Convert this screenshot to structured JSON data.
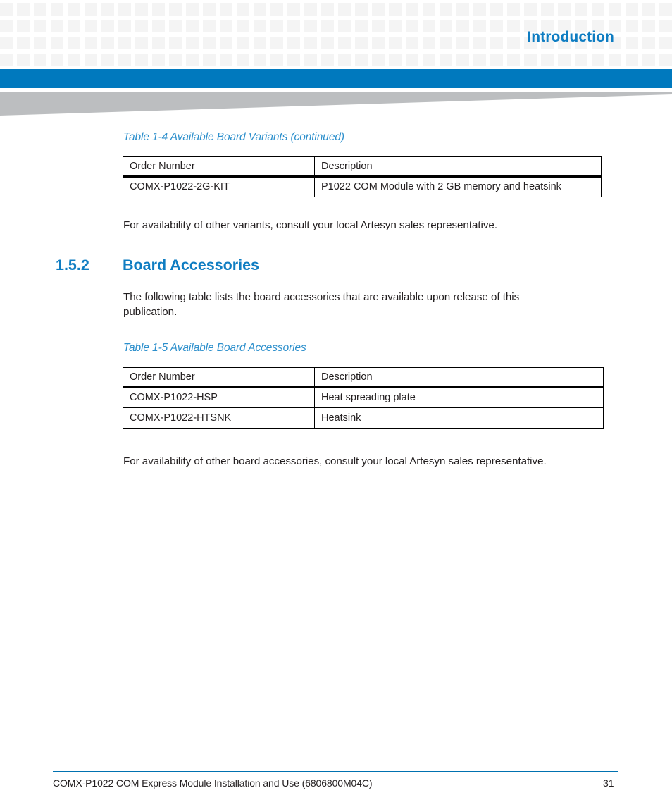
{
  "header": {
    "title": "Introduction",
    "accent_color": "#0f7dc2",
    "bar_color": "#0079be",
    "wedge_color": "#bcbec0",
    "grid_cell_color": "#f4f4f4"
  },
  "content": {
    "table_1_4": {
      "caption": "Table 1-4 Available Board Variants  (continued)",
      "columns": [
        "Order Number",
        "Description"
      ],
      "rows": [
        [
          "COMX-P1022-2G-KIT",
          "P1022 COM Module with 2 GB memory and heatsink"
        ]
      ]
    },
    "para_variants": "For availability of other variants, consult your local Artesyn sales representative.",
    "section": {
      "number": "1.5.2",
      "title": "Board Accessories"
    },
    "para_following": "The following table lists the board accessories that are available upon release of this publication.",
    "table_1_5": {
      "caption": "Table 1-5 Available Board Accessories",
      "columns": [
        "Order Number",
        "Description"
      ],
      "rows": [
        [
          "COMX-P1022-HSP",
          "Heat spreading plate"
        ],
        [
          "COMX-P1022-HTSNK",
          "Heatsink"
        ]
      ]
    },
    "para_accessories": "For availability of other board accessories, consult your local Artesyn sales representative."
  },
  "footer": {
    "document_title": "COMX-P1022 COM Express Module Installation and Use (6806800M04C)",
    "page_number": "31",
    "rule_color": "#0071b0"
  }
}
